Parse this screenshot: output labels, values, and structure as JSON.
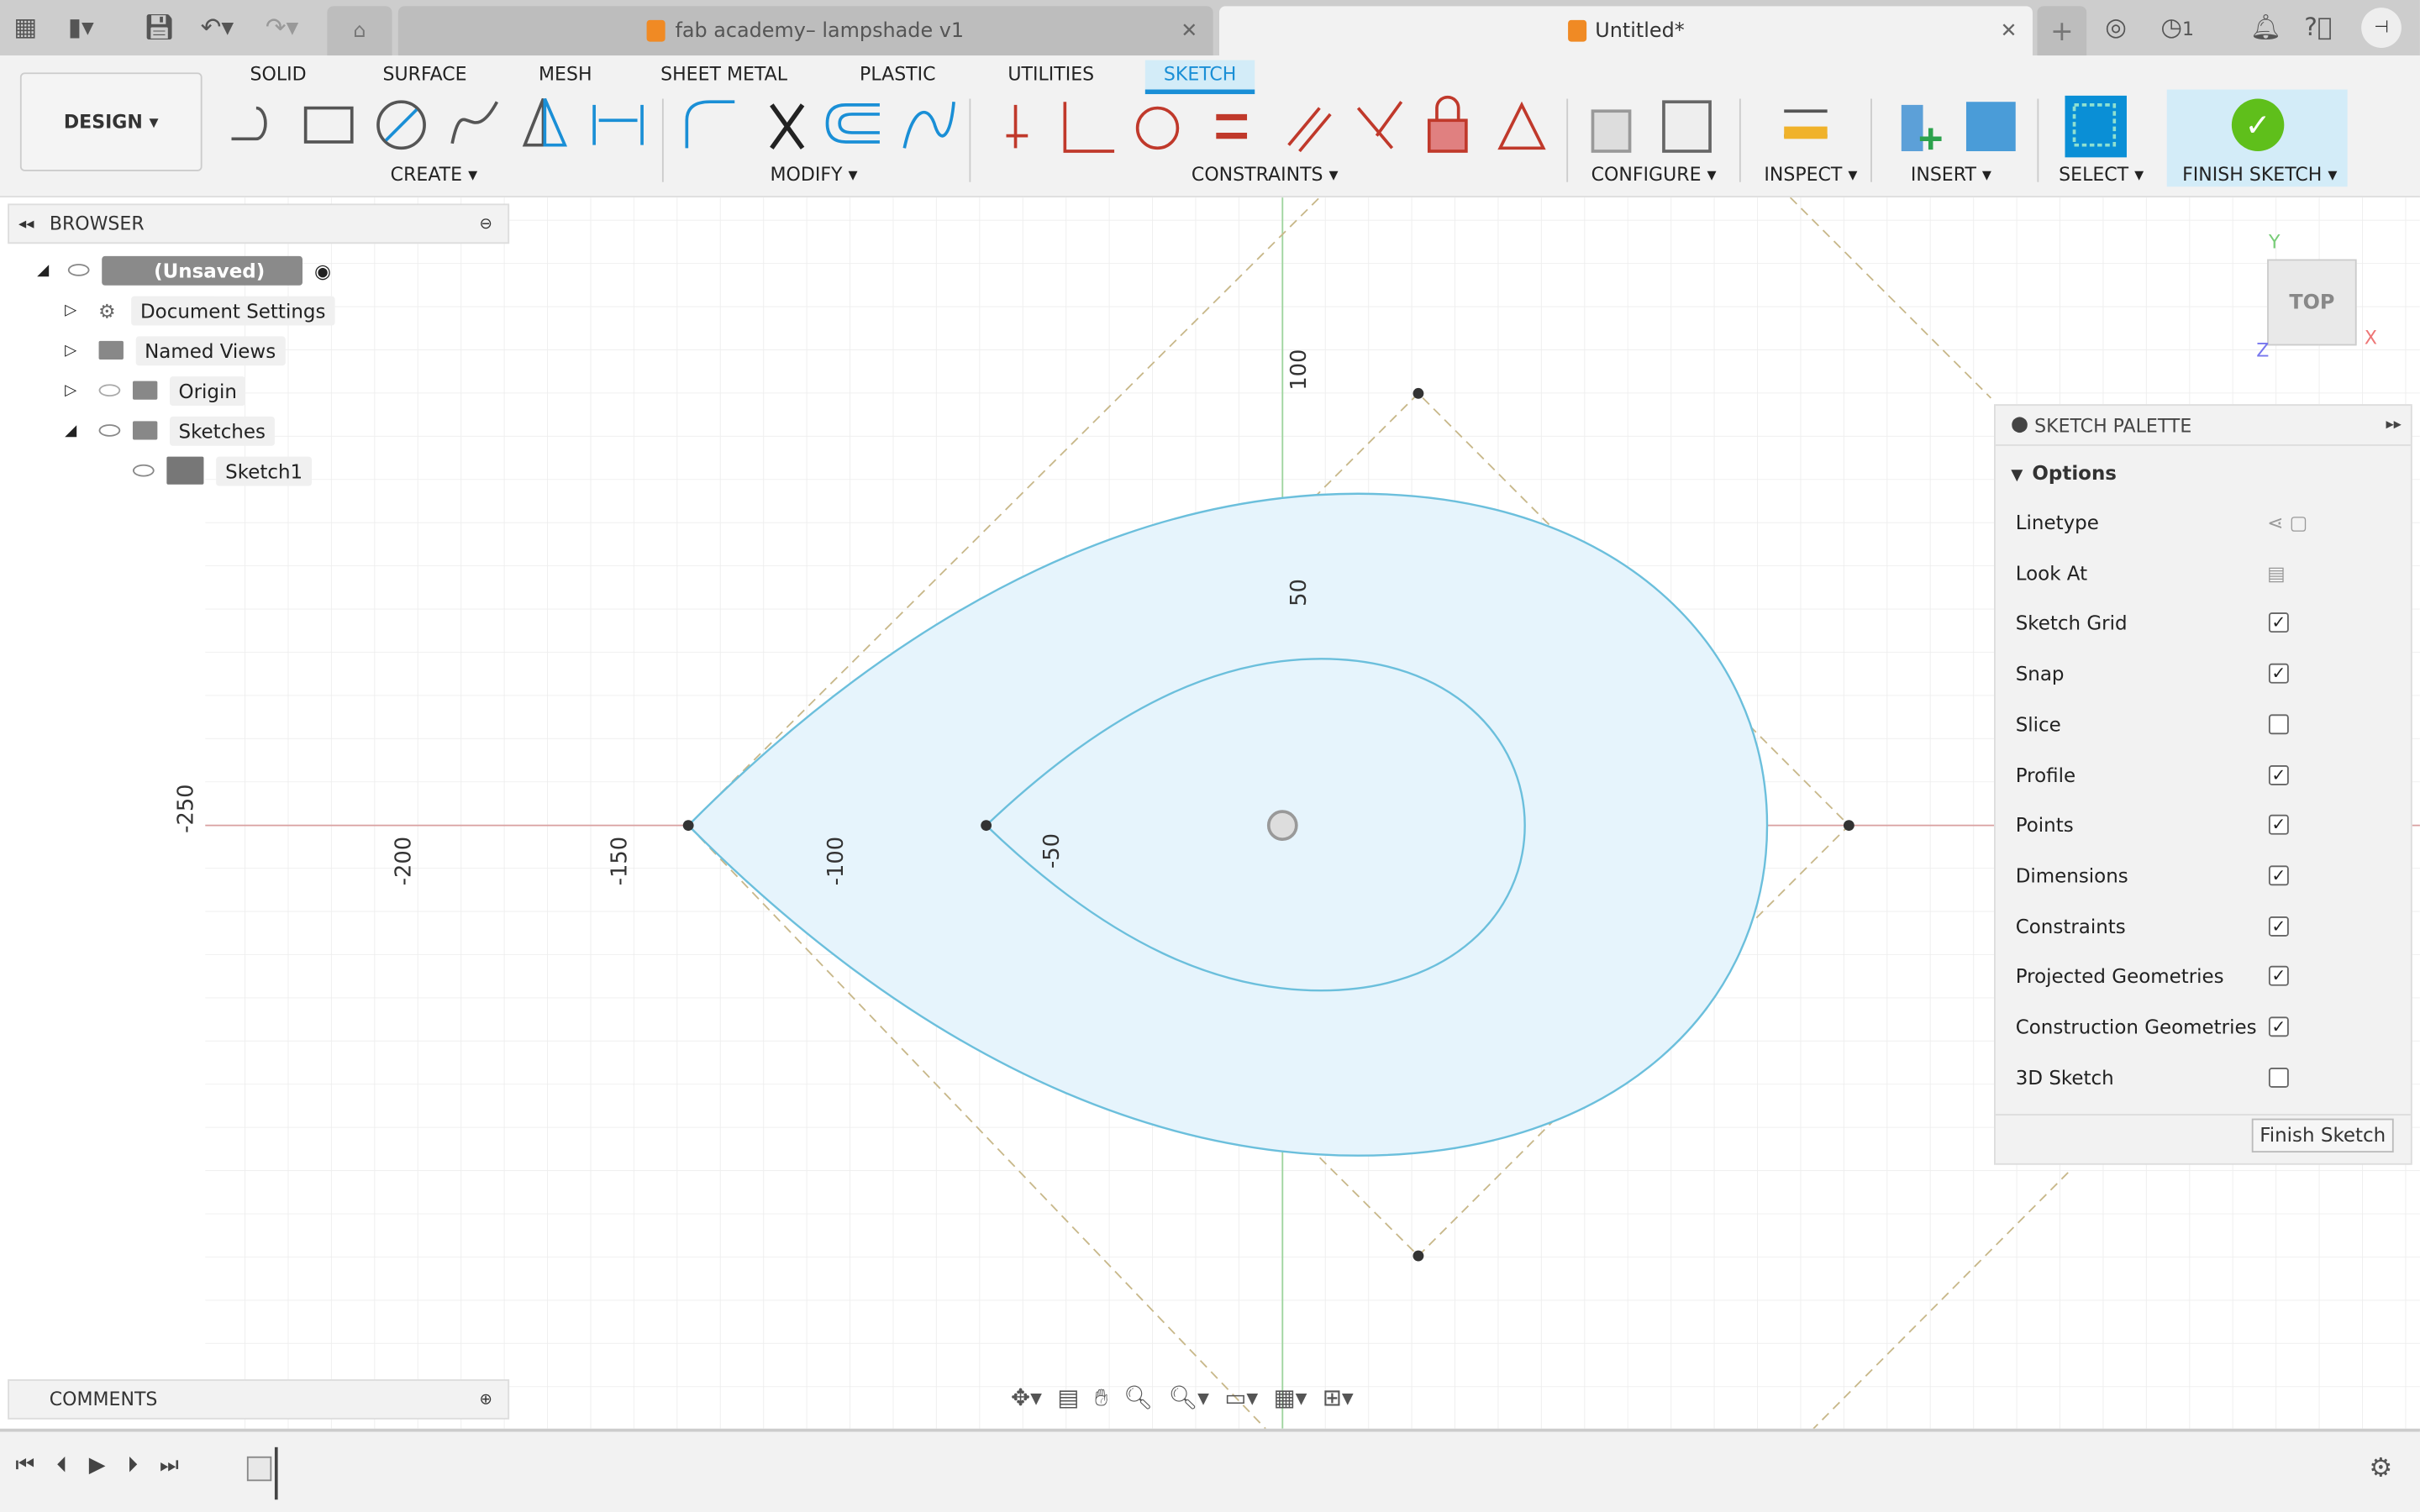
{
  "tabs": [
    {
      "title": "fab academy– lampshade v1",
      "active": false
    },
    {
      "title": "Untitled*",
      "active": true
    }
  ],
  "topbar": {
    "job_count": "1"
  },
  "workspace": "DESIGN ▾",
  "ribbon_tabs": [
    "SOLID",
    "SURFACE",
    "MESH",
    "SHEET METAL",
    "PLASTIC",
    "UTILITIES",
    "SKETCH"
  ],
  "active_ribbon_tab": "SKETCH",
  "groups": {
    "create": "CREATE ▾",
    "modify": "MODIFY ▾",
    "constraints": "CONSTRAINTS ▾",
    "configure": "CONFIGURE ▾",
    "inspect": "INSPECT ▾",
    "insert": "INSERT ▾",
    "select": "SELECT ▾",
    "finish": "FINISH SKETCH ▾"
  },
  "browser": {
    "title": "BROWSER",
    "items": [
      {
        "label": "(Unsaved)"
      },
      {
        "label": "Document Settings"
      },
      {
        "label": "Named Views"
      },
      {
        "label": "Origin"
      },
      {
        "label": "Sketches"
      },
      {
        "label": "Sketch1"
      }
    ]
  },
  "comments": "COMMENTS",
  "axis_labels": {
    "x": [
      "-250",
      "-200",
      "-150",
      "-100",
      "-50"
    ],
    "y": [
      "100",
      "50"
    ]
  },
  "viewcube": {
    "face": "TOP",
    "x": "X",
    "y": "Y",
    "z": "Z"
  },
  "palette": {
    "title": "SKETCH PALETTE",
    "section": "Options",
    "rows": [
      {
        "label": "Linetype",
        "type": "icons"
      },
      {
        "label": "Look At",
        "type": "icon"
      },
      {
        "label": "Sketch Grid",
        "checked": true
      },
      {
        "label": "Snap",
        "checked": true
      },
      {
        "label": "Slice",
        "checked": false
      },
      {
        "label": "Profile",
        "checked": true
      },
      {
        "label": "Points",
        "checked": true
      },
      {
        "label": "Dimensions",
        "checked": true
      },
      {
        "label": "Constraints",
        "checked": true
      },
      {
        "label": "Projected Geometries",
        "checked": true
      },
      {
        "label": "Construction Geometries",
        "checked": true
      },
      {
        "label": "3D Sketch",
        "checked": false
      }
    ],
    "finish_button": "Finish Sketch"
  },
  "colors": {
    "accent": "#1a8fd6",
    "profile_fill": "#e6f4fc",
    "curve": "#6bbfdc",
    "construction": "#c8b88a",
    "finish_green": "#5fbf1b"
  }
}
